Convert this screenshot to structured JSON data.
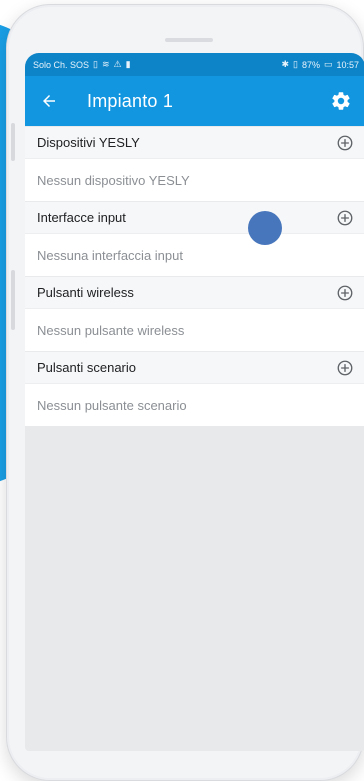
{
  "status_bar": {
    "left_text": "Solo Ch. SOS",
    "right_text": "87%",
    "time": "10:57"
  },
  "app_bar": {
    "title": "Impianto 1"
  },
  "sections": [
    {
      "title": "Dispositivi YESLY",
      "empty_text": "Nessun dispositivo YESLY"
    },
    {
      "title": "Interfacce input",
      "empty_text": "Nessuna interfaccia input"
    },
    {
      "title": "Pulsanti wireless",
      "empty_text": "Nessun pulsante wireless"
    },
    {
      "title": "Pulsanti scenario",
      "empty_text": "Nessun pulsante scenario"
    }
  ],
  "colors": {
    "accent": "#1296e0",
    "status_bar": "#0d84c8",
    "touch_indicator": "#3d6fb8"
  },
  "icons": {
    "back": "arrow-left-icon",
    "settings": "gear-icon",
    "add": "plus-circle-icon"
  }
}
